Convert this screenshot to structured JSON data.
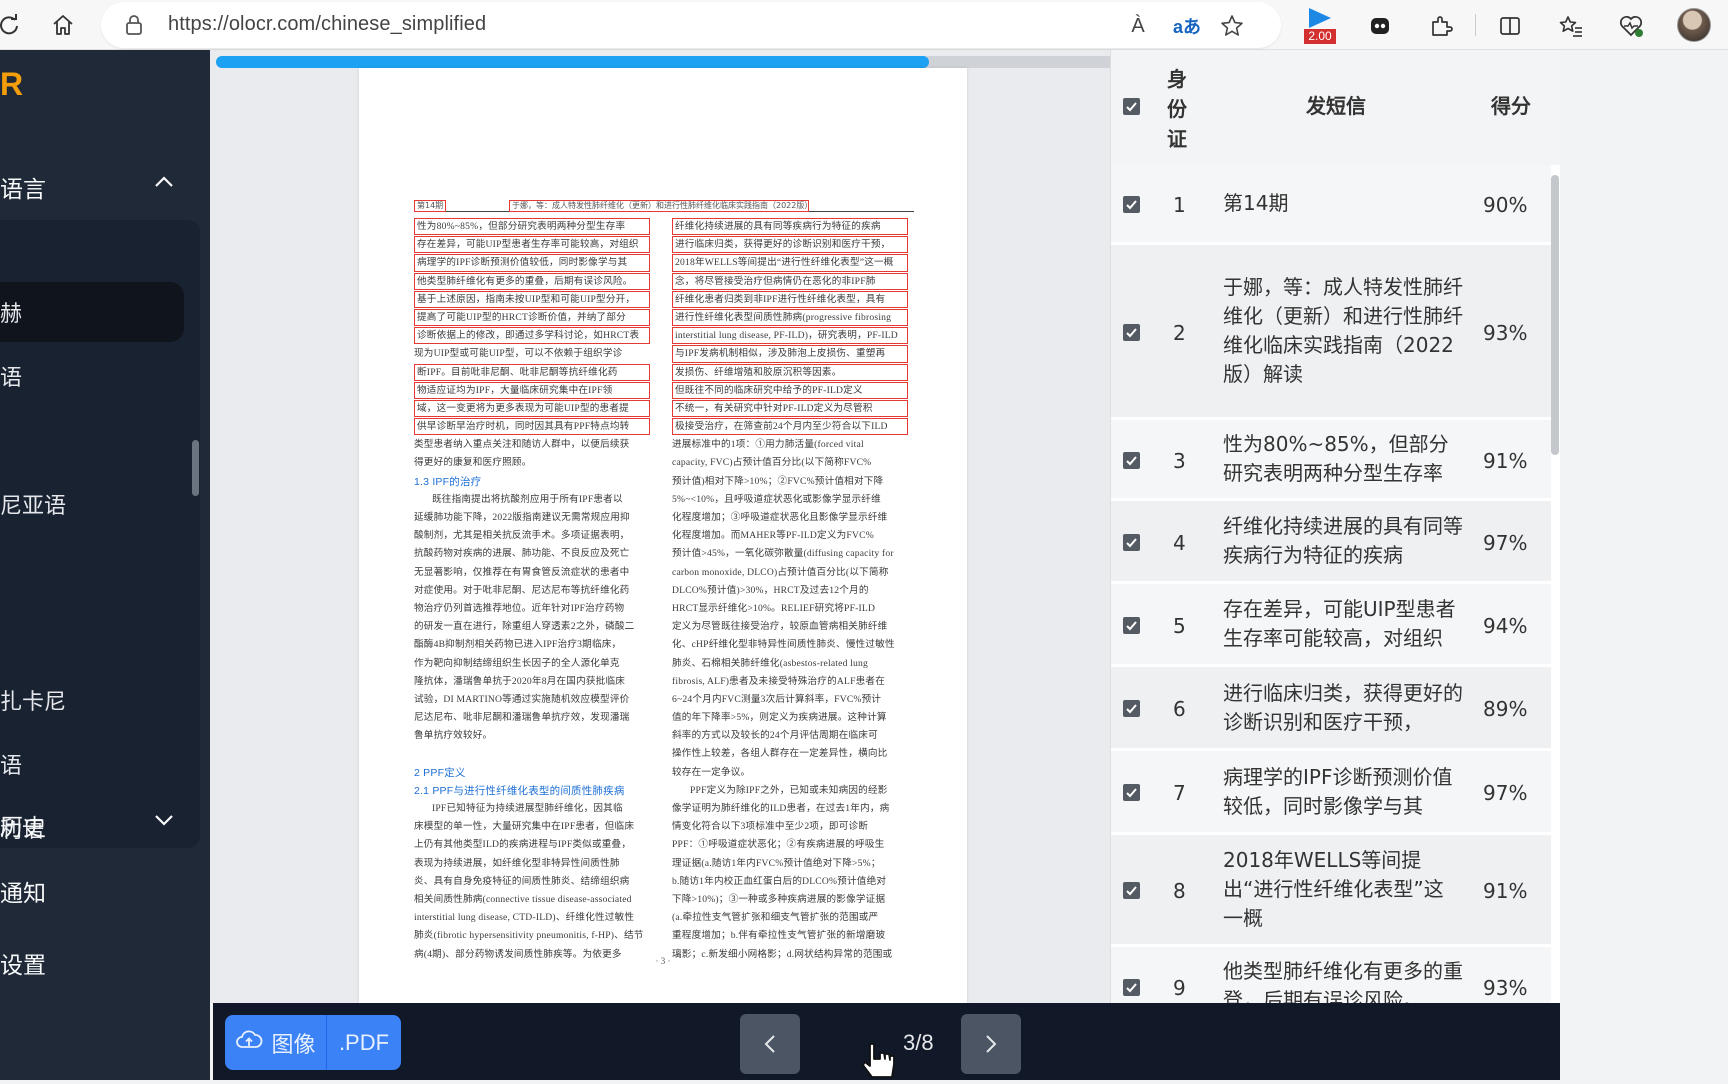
{
  "browser": {
    "url": "https://olocr.com/chinese_simplified",
    "read_aloud_label": "À",
    "translate_label": "aあ",
    "extension_badge": "2.00"
  },
  "sidebar": {
    "logo": "R",
    "language_section": "语言",
    "languages": [
      "赫",
      "语",
      "尼亚语",
      "扎卡尼",
      "语",
      "利语"
    ],
    "history_section": "历史",
    "notifications": "通知",
    "settings": "设置"
  },
  "viewer": {
    "progress_percent": 79,
    "page_header": {
      "left": "第14期",
      "right": "于娜，等：成人特发性肺纤维化（更新）和进行性肺纤维化临床实践指南（2022版）解读"
    },
    "left_column": [
      {
        "t": "性为80%~85%，但部分研究表明两种分型生存率",
        "hl": true
      },
      {
        "t": "存在差异，可能UIP型患者生存率可能较高，对组织",
        "hl": true
      },
      {
        "t": "病理学的IPF诊断预测价值较低，同时影像学与其",
        "hl": true
      },
      {
        "t": "他类型肺纤维化有更多的重叠，后期有误诊风险。",
        "hl": true
      },
      {
        "t": "基于上述原因，指南未按UIP型和可能UIP型分开，",
        "hl": true
      },
      {
        "t": "提高了可能UIP型的HRCT诊断价值，并纳了部分",
        "hl": true
      },
      {
        "t": "诊断依据上的修改，即通过多学科讨论，如HRCT表",
        "hl": true
      },
      {
        "t": "现为UIP型或可能UIP型，可以不依赖于组织学诊",
        "hl": false
      },
      {
        "t": "断IPF。目前吡非尼酮、吡非尼酮等抗纤维化药",
        "hl": true
      },
      {
        "t": "物适应证均为IPF，大量临床研究集中在IPF领",
        "hl": true
      },
      {
        "t": "域，这一变更将为更多表现为可能UIP型的患者提",
        "hl": true
      },
      {
        "t": "供早诊断早治疗时机，同时因其具有PPF特点均转",
        "hl": true
      },
      {
        "t": "类型患者纳入重点关注和随访人群中，以便后续获",
        "hl": false
      },
      {
        "t": "得更好的康复和医疗照顾。",
        "hl": false
      },
      {
        "t": "1.3  IPF的治疗",
        "heading": true
      },
      {
        "t": "既往指南提出将抗酸剂应用于所有IPF患者以",
        "indent": true
      },
      {
        "t": "延缓肺功能下降，2022版指南建议无需常规应用抑",
        "hl": false
      },
      {
        "t": "酸制剂，尤其是相关抗反流手术。多项证据表明，",
        "hl": false
      },
      {
        "t": "抗酸药物对疾病的进展、肺功能、不良反应及死亡",
        "hl": false
      },
      {
        "t": "无显著影响，仅推荐在有胃食管反流症状的患者中",
        "hl": false
      },
      {
        "t": "对症使用。对于吡非尼酮、尼达尼布等抗纤维化药",
        "hl": false
      },
      {
        "t": "物治疗仍列首选推荐地位。近年针对IPF治疗药物",
        "hl": false
      },
      {
        "t": "的研发一直在进行，除重组人穿透素2之外，磷酸二",
        "hl": false
      },
      {
        "t": "酯酶4B抑制剂相关药物已进入IPF治疗3期临床，",
        "hl": false
      },
      {
        "t": "作为靶向抑制结缔组织生长因子的全人源化单克",
        "hl": false
      },
      {
        "t": "隆抗体，潘瑞鲁单抗于2020年8月在国内获批临床",
        "hl": false
      },
      {
        "t": "试验，DI MARTINO等通过实施随机效应模型评价",
        "hl": false
      },
      {
        "t": "尼达尼布、吡非尼酮和潘瑞鲁单抗疗效，发现潘瑞",
        "hl": false
      },
      {
        "t": "鲁单抗疗效较好。",
        "hl": false
      },
      {
        "t": "",
        "hl": false
      },
      {
        "t": "2  PPF定义",
        "heading": true
      },
      {
        "t": "2.1  PPF与进行性纤维化表型的间质性肺疾病",
        "heading": true
      },
      {
        "t": "IPF已知特征为持续进展型肺纤维化，因其临",
        "indent": true
      },
      {
        "t": "床模型的单一性，大量研究集中在IPF患者，但临床",
        "hl": false
      },
      {
        "t": "上仍有其他类型ILD的疾病进程与IPF类似或重叠，",
        "hl": false
      },
      {
        "t": "表现为持续进展，如纤维化型非特异性间质性肺",
        "hl": false
      },
      {
        "t": "炎、具有自身免疫特征的间质性肺炎、结缔组织病",
        "hl": false
      },
      {
        "t": "相关间质性肺病(connective tissue disease-associated",
        "hl": false
      },
      {
        "t": "interstitial lung disease, CTD-ILD)、纤维化性过敏性",
        "hl": false
      },
      {
        "t": "肺炎(fibrotic hypersensitivity pneumonitis, f-HP)、结节",
        "hl": false
      },
      {
        "t": "病(4期)、部分药物诱发间质性肺疾等。为依更多",
        "hl": false
      }
    ],
    "right_column": [
      {
        "t": "纤维化持续进展的具有同等疾病行为特征的疾病",
        "hl": true
      },
      {
        "t": "进行临床归类，获得更好的诊断识别和医疗干预，",
        "hl": true
      },
      {
        "t": "2018年WELLS等间提出“进行性纤维化表型”这一概",
        "hl": true
      },
      {
        "t": "念，将尽管接受治疗但病情仍在恶化的非IPF肺",
        "hl": true
      },
      {
        "t": "纤维化患者归类到非IPF进行性纤维化表型，具有",
        "hl": true
      },
      {
        "t": "进行性纤维化表型间质性肺病(progressive fibrosing",
        "hl": true
      },
      {
        "t": "interstitial lung disease, PF-ILD)，研究表明，PF-ILD",
        "hl": true
      },
      {
        "t": "与IPF发病机制相似，涉及肺泡上皮损伤、重塑再",
        "hl": true
      },
      {
        "t": "发损伤、纤维增殖和胶原沉积等因素。",
        "hl": true
      },
      {
        "t": "但既往不同的临床研究中给予的PF-ILD定义",
        "hl": true
      },
      {
        "t": "不统一，有关研究中针对PF-ILD定义为尽管积",
        "hl": true
      },
      {
        "t": "极接受治疗，在筛查前24个月内至少符合以下ILD",
        "hl": true
      },
      {
        "t": "进展标准中的1项：①用力肺活量(forced vital",
        "hl": false
      },
      {
        "t": "capacity, FVC)占预计值百分比(以下简称FVC%",
        "hl": false
      },
      {
        "t": "预计值)相对下降>10%；②FVC%预计值相对下降",
        "hl": false
      },
      {
        "t": "5%~<10%，且呼吸道症状恶化或影像学显示纤维",
        "hl": false
      },
      {
        "t": "化程度增加；③呼吸道症状恶化且影像学显示纤维",
        "hl": false
      },
      {
        "t": "化程度增加。而MAHER等PF-ILD定义为FVC%",
        "hl": false
      },
      {
        "t": "预计值>45%，一氧化碳弥散量(diffusing capacity for",
        "hl": false
      },
      {
        "t": "carbon monoxide, DLCO)占预计值百分比(以下简称",
        "hl": false
      },
      {
        "t": "DLCO%预计值)>30%，HRCT及过去12个月的",
        "hl": false
      },
      {
        "t": "HRCT显示纤维化>10%。RELIEF研究将PF-ILD",
        "hl": false
      },
      {
        "t": "定义为尽管既往接受治疗，较原血管病相关肺纤维",
        "hl": false
      },
      {
        "t": "化、cHP纤维化型非特异性间质性肺炎、慢性过敏性",
        "hl": false
      },
      {
        "t": "肺炎、石棉相关肺纤维化(asbestos-related lung",
        "hl": false
      },
      {
        "t": "fibrosis, ALF)患者及未接受特殊治疗的ALF患者在",
        "hl": false
      },
      {
        "t": "6~24个月内FVC测量3次后计算斜率，FVC%预计",
        "hl": false
      },
      {
        "t": "值的年下降率>5%，则定义为疾病进展。这种计算",
        "hl": false
      },
      {
        "t": "斜率的方式以及较长的24个月评估周期在临床可",
        "hl": false
      },
      {
        "t": "操作性上较差，各组人群存在一定差异性，横向比",
        "hl": false
      },
      {
        "t": "较存在一定争议。",
        "hl": false
      },
      {
        "t": "PPF定义为除IPF之外，已知或未知病因的经影",
        "indent": true
      },
      {
        "t": "像学证明为肺纤维化的ILD患者，在过去1年内，病",
        "hl": false
      },
      {
        "t": "情变化符合以下3项标准中至少2项，即可诊断",
        "hl": false
      },
      {
        "t": "PPF：①呼吸道症状恶化；②有疾病进展的呼吸生",
        "hl": false
      },
      {
        "t": "理证据(a.随访1年内FVC%预计值绝对下降>5%；",
        "hl": false
      },
      {
        "t": "b.随访1年内校正血红蛋白后的DLCO%预计值绝对",
        "hl": false
      },
      {
        "t": "下降>10%)；③一种或多种疾病进展的影像学证据",
        "hl": false
      },
      {
        "t": "(a.牵拉性支气管扩张和细支气管扩张的范围或严",
        "hl": false
      },
      {
        "t": "重程度增加；b.伴有牵拉性支气管扩张的新增磨玻",
        "hl": false
      },
      {
        "t": "璃影；c.新发细小网格影；d.网状结构异常的范围或",
        "hl": false
      }
    ],
    "page_number": "· 3 ·"
  },
  "results": {
    "header": {
      "id": "身份证",
      "text": "发短信",
      "score": "得分"
    },
    "rows": [
      {
        "id": "1",
        "text": "第14期",
        "score": "90%"
      },
      {
        "id": "2",
        "text": "于娜，等：成人特发性肺纤维化（更新）和进行性肺纤维化临床实践指南（2022版）解读",
        "score": "93%"
      },
      {
        "id": "3",
        "text": "性为80%~85%，但部分研究表明两种分型生存率",
        "score": "91%"
      },
      {
        "id": "4",
        "text": "纤维化持续进展的具有同等疾病行为特征的疾病",
        "score": "97%"
      },
      {
        "id": "5",
        "text": "存在差异，可能UIP型患者生存率可能较高，对组织",
        "score": "94%"
      },
      {
        "id": "6",
        "text": "进行临床归类，获得更好的诊断识别和医疗干预，",
        "score": "89%"
      },
      {
        "id": "7",
        "text": "病理学的IPF诊断预测价值较低，同时影像学与其",
        "score": "97%"
      },
      {
        "id": "8",
        "text": "2018年WELLS等间提出“进行性纤维化表型”这一概",
        "score": "91%"
      },
      {
        "id": "9",
        "text": "他类型肺纤维化有更多的重登，后期有误诊风险。",
        "score": "93%"
      }
    ]
  },
  "bottom": {
    "image_label": "图像",
    "pdf_label": ".PDF",
    "pager": "3/8"
  },
  "colors": {
    "accent": "#3b82f6",
    "progress": "#1da1f2",
    "highlight": "#e53935",
    "sidebar": "#1f2937",
    "logo": "#f59e0b"
  }
}
